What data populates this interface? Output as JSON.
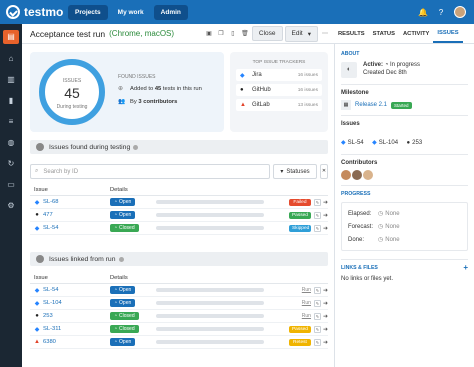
{
  "topbar": {
    "brand": "testmo",
    "nav": [
      {
        "label": "Projects",
        "active": true
      },
      {
        "label": "My work",
        "active": false
      },
      {
        "label": "Admin",
        "active": true
      }
    ]
  },
  "header": {
    "title": "Acceptance test run",
    "subtitle": "(Chrome, macOS)",
    "close_label": "Close",
    "edit_label": "Edit"
  },
  "right_tabs": [
    "RESULTS",
    "STATUS",
    "ACTIVITY",
    "ISSUES"
  ],
  "summary": {
    "ring_label": "ISSUES",
    "ring_value": "45",
    "ring_sub": "During testing",
    "found_heading": "FOUND ISSUES",
    "found_line1_pre": "Added to ",
    "found_line1_bold": "45",
    "found_line1_post": " tests in this run",
    "found_line2_pre": "By ",
    "found_line2_bold": "3 contributors"
  },
  "trackers": {
    "heading": "TOP ISSUE TRACKERS",
    "items": [
      {
        "name": "Jira",
        "count": "16 issues",
        "color": "#2684ff"
      },
      {
        "name": "GitHub",
        "count": "16 issues",
        "color": "#222222"
      },
      {
        "name": "GitLab",
        "count": "13 issues",
        "color": "#e2432a"
      }
    ]
  },
  "found_section": {
    "title": "Issues found during testing",
    "search_placeholder": "Search by ID",
    "status_filter": "Statuses",
    "col_issue": "Issue",
    "col_details": "Details",
    "rows": [
      {
        "id": "SL-68",
        "tracker": "jira",
        "status": "Open",
        "result": "Failed",
        "result_color": "#e54b2e"
      },
      {
        "id": "477",
        "tracker": "github",
        "status": "Open",
        "result": "Passed",
        "result_color": "#39a854"
      },
      {
        "id": "SL-54",
        "tracker": "jira",
        "status": "Closed",
        "result": "Skipped",
        "result_color": "#2f9fd8"
      }
    ]
  },
  "linked_section": {
    "title": "Issues linked from run",
    "col_issue": "Issue",
    "col_details": "Details",
    "rows": [
      {
        "id": "SL-54",
        "tracker": "jira",
        "status": "Open",
        "result": "Run",
        "is_run": true
      },
      {
        "id": "SL-104",
        "tracker": "jira",
        "status": "Open",
        "result": "Run",
        "is_run": true
      },
      {
        "id": "253",
        "tracker": "github",
        "status": "Closed",
        "result": "Run",
        "is_run": true
      },
      {
        "id": "SL-311",
        "tracker": "jira",
        "status": "Closed",
        "result": "Passed",
        "result_color": "#f0b400",
        "is_run": false
      },
      {
        "id": "6380",
        "tracker": "gitlab",
        "status": "Open",
        "result": "Retest",
        "result_color": "#f0b400",
        "is_run": false
      }
    ]
  },
  "status_colors": {
    "Open": "#1a6fb8",
    "Closed": "#39a854"
  },
  "right_panel": {
    "about_heading": "ABOUT",
    "active_label": "Active:",
    "active_value": "In progress",
    "created": "Created Dec 8th",
    "milestone_heading": "Milestone",
    "milestone_name": "Release 2.1",
    "milestone_badge": "Started",
    "issues_heading": "Issues",
    "issues": [
      "SL-54",
      "SL-104",
      "253"
    ],
    "contributors_heading": "Contributors",
    "progress_heading": "PROGRESS",
    "progress_rows": [
      {
        "k": "Elapsed:",
        "v": "None"
      },
      {
        "k": "Forecast:",
        "v": "None"
      },
      {
        "k": "Done:",
        "v": "None"
      }
    ],
    "links_heading": "LINKS & FILES",
    "links_empty": "No links or files yet."
  }
}
